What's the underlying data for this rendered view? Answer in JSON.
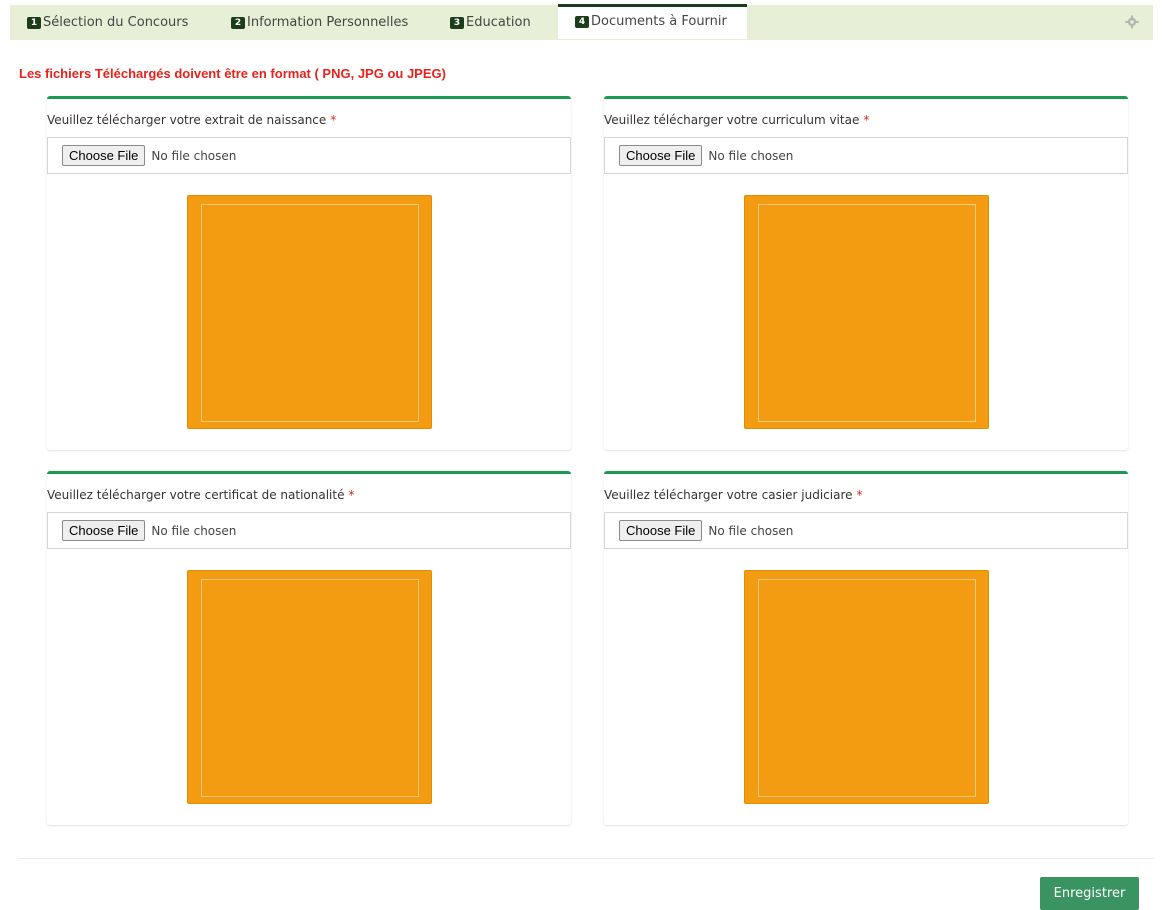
{
  "tabs": [
    {
      "num": "1",
      "label": "Sélection du Concours"
    },
    {
      "num": "2",
      "label": "Information Personnelles"
    },
    {
      "num": "3",
      "label": "Education"
    },
    {
      "num": "4",
      "label": "Documents à Fournir"
    }
  ],
  "active_tab": "Documents à Fournir",
  "settings_icon": "gear-icon",
  "warning": "Les fichiers Téléchargés doivent être en format ( PNG, JPG ou JPEG)",
  "uploads": [
    {
      "label": "Veuillez télécharger votre extrait de naissance",
      "required": "*",
      "button": "Choose File",
      "status": "No file chosen"
    },
    {
      "label": "Veuillez télécharger votre curriculum vitae",
      "required": "*",
      "button": "Choose File",
      "status": "No file chosen"
    },
    {
      "label": "Veuillez télécharger votre certificat de nationalité",
      "required": "*",
      "button": "Choose File",
      "status": "No file chosen"
    },
    {
      "label": "Veuillez télécharger votre casier judiciare",
      "required": "*",
      "button": "Choose File",
      "status": "No file chosen"
    }
  ],
  "save_label": "Enregistrer",
  "colors": {
    "tab_bar": "#e7f0d6",
    "panel_accent": "#1b9a52",
    "preview_fill": "#f39c12",
    "warning_text": "#e8221b",
    "save_button": "#3a9462"
  }
}
